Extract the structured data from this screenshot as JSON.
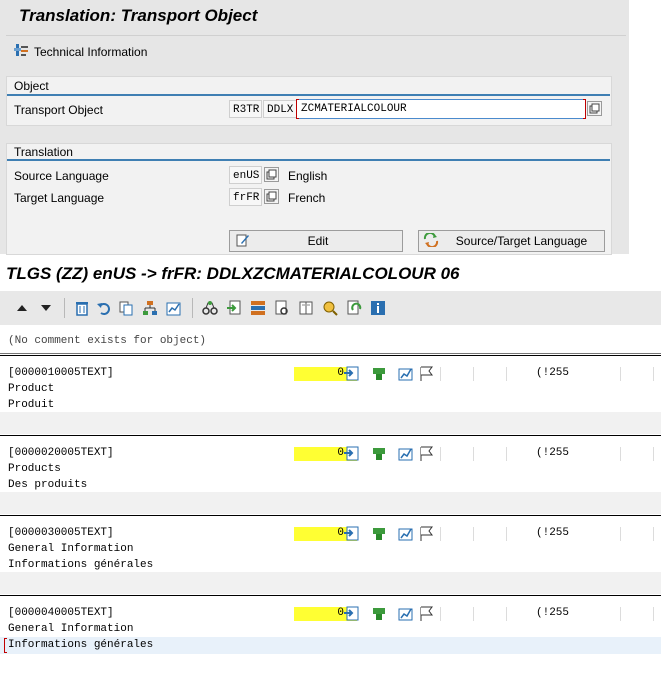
{
  "top": {
    "title": "Translation: Transport Object",
    "tech_info_label": "Technical Information",
    "object_group": {
      "title": "Object",
      "transport_object_label": "Transport Object",
      "pgmid": "R3TR",
      "object_type": "DDLX",
      "object_name": "ZCMATERIALCOLOUR"
    },
    "translation_group": {
      "title": "Translation",
      "source_label": "Source Language",
      "source_code": "enUS",
      "source_name": "English",
      "target_label": "Target Language",
      "target_code": "frFR",
      "target_name": "French"
    },
    "edit_button": "Edit",
    "source_target_button": "Source/Target Language"
  },
  "editor": {
    "title": "TLGS (ZZ) enUS -> frFR: DDLXZCMATERIALCOLOUR 06",
    "comment": "(No comment exists for object)",
    "entries": [
      {
        "key": "[0000010005TEXT]",
        "count": "0",
        "maxlen": "(!255",
        "source": "Product",
        "target": "Produit"
      },
      {
        "key": "[0000020005TEXT]",
        "count": "0",
        "maxlen": "(!255",
        "source": "Products",
        "target": "Des produits"
      },
      {
        "key": "[0000030005TEXT]",
        "count": "0",
        "maxlen": "(!255",
        "source": "General Information",
        "target": "Informations générales"
      },
      {
        "key": "[0000040005TEXT]",
        "count": "0",
        "maxlen": "(!255",
        "source": "General Information",
        "target": "Informations générales"
      }
    ]
  },
  "colors": {
    "highlight": "#ffff33",
    "accent": "#3f7fb3",
    "green": "#3c9a3c"
  }
}
